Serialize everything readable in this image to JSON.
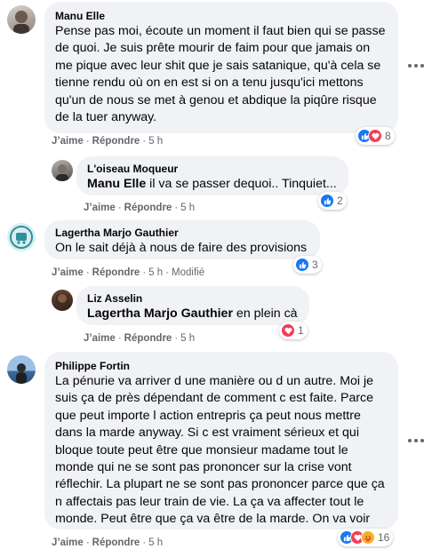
{
  "labels": {
    "like": "J’aime",
    "reply": "Répondre",
    "sep": "·",
    "modified": "Modifié"
  },
  "comments": [
    {
      "author": "Manu Elle",
      "text": "Pense pas moi, écoute un moment il faut bien qui se passe de quoi. Je suis prête mourir de faim pour que jamais on me pique avec leur shit que je sais satanique, qu'à cela se tienne rendu où on en est si on a tenu jusqu'ici mettons qu'un de nous se met à genou et abdique la piqûre risque de la tuer anyway.",
      "time": "5 h",
      "reaction_count": "8",
      "reactions": [
        "like-icon",
        "love-icon"
      ]
    },
    {
      "author": "L'oiseau Moqueur",
      "mention": "Manu Elle",
      "text": " il va se passer dequoi.. Tinquiet...",
      "time": "5 h",
      "reaction_count": "2",
      "reactions": [
        "like-icon"
      ]
    },
    {
      "author": "Lagertha Marjo Gauthier",
      "text": "On le sait déjà à nous de faire des provisions",
      "time": "5 h",
      "reaction_count": "3",
      "reactions": [
        "like-icon"
      ]
    },
    {
      "author": "Liz Asselin",
      "mention": "Lagertha Marjo Gauthier",
      "text": " en plein cà",
      "time": "5 h",
      "reaction_count": "1",
      "reactions": [
        "love-icon"
      ]
    },
    {
      "author": "Philippe Fortin",
      "text": "La pénurie va arriver d une manière ou d un autre. Moi je suis ça de près dépendant de comment c est faite. Parce que peut importe l action entrepris ça peut nous mettre dans la marde anyway. Si c est vraiment sérieux et qui bloque toute peut être que monsieur madame tout le monde qui ne se sont pas prononcer sur la crise vont réflechir. La plupart ne se sont pas prononcer parce que ça n affectais pas leur train de vie. La ça va affecter tout le monde. Peut être que ça va être de la marde. On va voir",
      "time": "5 h",
      "reaction_count": "16",
      "reactions": [
        "like-icon",
        "love-icon",
        "care-icon"
      ]
    }
  ],
  "colors": {
    "bubble": "#f0f2f5",
    "meta": "#65676b",
    "like": "#1877f2",
    "love": "#f33e58",
    "care": "#f7b125"
  }
}
